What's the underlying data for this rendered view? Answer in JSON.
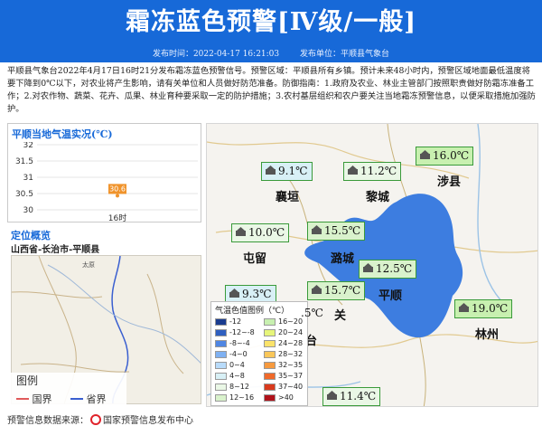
{
  "header": {
    "title": "霜冻蓝色预警[Ⅳ级/一般]",
    "issue_time": "发布时间：2022-04-17 16:21:03",
    "issuer": "发布单位：平顺县气象台"
  },
  "description": "平顺县气象台2022年4月17日16时21分发布霜冻蓝色预警信号。预警区域：平顺县所有乡镇。预计未来48小时内，预警区域地面最低温度将要下降到0℃以下，对农业将产生影响，请有关单位和人员做好防范准备。防御指南：1.政府及农业、林业主管部门按照职责做好防霜冻准备工作；2.对农作物、蔬菜、花卉、瓜果、林业育种要采取一定的防护措施；3.农村基层组织和农户要关注当地霜冻预警信息，以便采取措施加强防护。",
  "temp_panel": {
    "title": "平顺当地气温实况(℃)",
    "chart_data": {
      "type": "scatter",
      "categories": [
        "16时"
      ],
      "values": [
        30.6
      ],
      "data_labels": [
        "30.6"
      ],
      "ylim": [
        30,
        32
      ],
      "yticks": [
        "32",
        "31.5",
        "31",
        "30.5",
        "30"
      ],
      "color": "#f0932b"
    }
  },
  "location": {
    "title": "定位概览",
    "path": "山西省-长治市-平顺县",
    "overview_place": "太原"
  },
  "map_legend": {
    "title": "图例",
    "national_border": "国界",
    "province_border": "省界",
    "national_color": "#e05a5a",
    "province_color": "#3a5fd0"
  },
  "map": {
    "color_legend_title": "气温色值图例（℃）",
    "color_legend": [
      {
        "label": "-12",
        "color": "#1a3c8f"
      },
      {
        "label": "16~20",
        "color": "#c8f0b0"
      },
      {
        "label": "-12~-8",
        "color": "#2f5fc0"
      },
      {
        "label": "20~24",
        "color": "#e6f57a"
      },
      {
        "label": "-8~-4",
        "color": "#4f86e3"
      },
      {
        "label": "24~28",
        "color": "#fbe36a"
      },
      {
        "label": "-4~0",
        "color": "#7fb1f2"
      },
      {
        "label": "28~32",
        "color": "#f9c75a"
      },
      {
        "label": "0~4",
        "color": "#b8dbfa"
      },
      {
        "label": "32~35",
        "color": "#f79a3e"
      },
      {
        "label": "4~8",
        "color": "#d8f0f6"
      },
      {
        "label": "35~37",
        "color": "#f06a2a"
      },
      {
        "label": "8~12",
        "color": "#eaf7e6"
      },
      {
        "label": "37~40",
        "color": "#d93a1d"
      },
      {
        "label": "12~16",
        "color": "#d9f2cc"
      },
      {
        "label": ">40",
        "color": "#b0121b"
      }
    ],
    "stations": [
      {
        "temp": "9.1℃",
        "bg": "#d8f0f6"
      },
      {
        "temp": "11.2℃",
        "bg": "#eaf7e6"
      },
      {
        "temp": "16.0℃",
        "bg": "#c8f0b0"
      },
      {
        "temp": "10.0℃",
        "bg": "#eaf7e6"
      },
      {
        "temp": "15.5℃",
        "bg": "#d9f2cc"
      },
      {
        "temp": "12.5℃",
        "bg": "#d9f2cc"
      },
      {
        "temp": "9.3℃",
        "bg": "#d8f0f6"
      },
      {
        "temp": "15.7℃",
        "bg": "#d9f2cc"
      },
      {
        "temp": "19.0℃",
        "bg": "#c8f0b0"
      },
      {
        "temp": "11.4℃",
        "bg": "#eaf7e6"
      }
    ],
    "partial_label": ".5℃",
    "cities": [
      "襄垣",
      "黎城",
      "涉县",
      "屯留",
      "潞城",
      "平顺",
      "林州",
      "关",
      "台"
    ],
    "region_color": "#3d7de0"
  },
  "footer": {
    "prefix": "预警信息数据来源：",
    "source": "国家预警信息发布中心"
  }
}
